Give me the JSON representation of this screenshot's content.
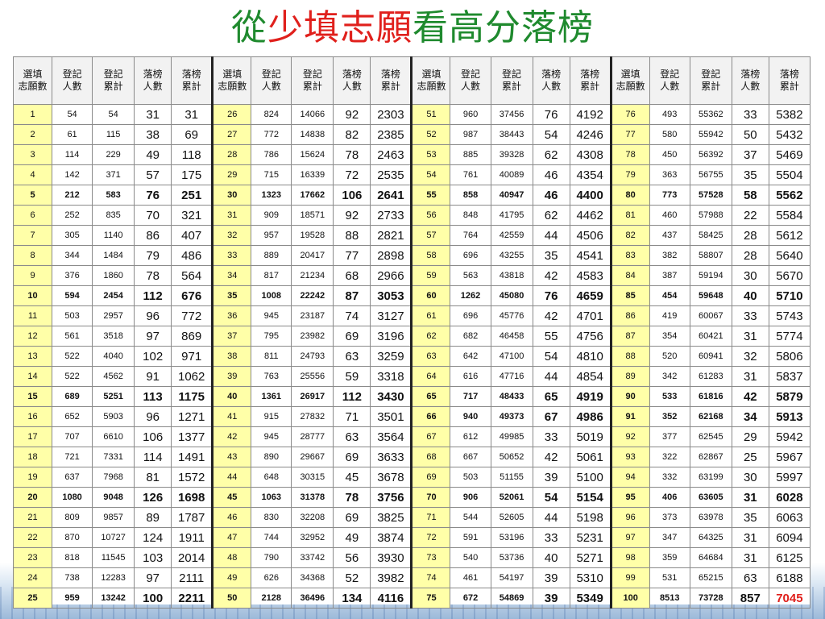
{
  "title": {
    "parts": [
      {
        "text": "從",
        "color": "#1f8a2e"
      },
      {
        "text": "少填志願",
        "color": "#e0201c"
      },
      {
        "text": "看高分落榜",
        "color": "#1f8a2e"
      }
    ]
  },
  "headers": [
    "選填志願數",
    "登記人數",
    "登記累計",
    "落榜人數",
    "落榜累計"
  ],
  "bold_rows": [
    5,
    10,
    15,
    20,
    25
  ],
  "extra_bold": [
    {
      "block": 2,
      "row": 16
    },
    {
      "block": 3,
      "row": 16
    }
  ],
  "highlight_color": "#ffffa8",
  "red_cell": {
    "block": 3,
    "row": 25,
    "col": 4
  },
  "blocks": [
    [
      [
        "1",
        "54",
        "54",
        "31",
        "31"
      ],
      [
        "2",
        "61",
        "115",
        "38",
        "69"
      ],
      [
        "3",
        "114",
        "229",
        "49",
        "118"
      ],
      [
        "4",
        "142",
        "371",
        "57",
        "175"
      ],
      [
        "5",
        "212",
        "583",
        "76",
        "251"
      ],
      [
        "6",
        "252",
        "835",
        "70",
        "321"
      ],
      [
        "7",
        "305",
        "1140",
        "86",
        "407"
      ],
      [
        "8",
        "344",
        "1484",
        "79",
        "486"
      ],
      [
        "9",
        "376",
        "1860",
        "78",
        "564"
      ],
      [
        "10",
        "594",
        "2454",
        "112",
        "676"
      ],
      [
        "11",
        "503",
        "2957",
        "96",
        "772"
      ],
      [
        "12",
        "561",
        "3518",
        "97",
        "869"
      ],
      [
        "13",
        "522",
        "4040",
        "102",
        "971"
      ],
      [
        "14",
        "522",
        "4562",
        "91",
        "1062"
      ],
      [
        "15",
        "689",
        "5251",
        "113",
        "1175"
      ],
      [
        "16",
        "652",
        "5903",
        "96",
        "1271"
      ],
      [
        "17",
        "707",
        "6610",
        "106",
        "1377"
      ],
      [
        "18",
        "721",
        "7331",
        "114",
        "1491"
      ],
      [
        "19",
        "637",
        "7968",
        "81",
        "1572"
      ],
      [
        "20",
        "1080",
        "9048",
        "126",
        "1698"
      ],
      [
        "21",
        "809",
        "9857",
        "89",
        "1787"
      ],
      [
        "22",
        "870",
        "10727",
        "124",
        "1911"
      ],
      [
        "23",
        "818",
        "11545",
        "103",
        "2014"
      ],
      [
        "24",
        "738",
        "12283",
        "97",
        "2111"
      ],
      [
        "25",
        "959",
        "13242",
        "100",
        "2211"
      ]
    ],
    [
      [
        "26",
        "824",
        "14066",
        "92",
        "2303"
      ],
      [
        "27",
        "772",
        "14838",
        "82",
        "2385"
      ],
      [
        "28",
        "786",
        "15624",
        "78",
        "2463"
      ],
      [
        "29",
        "715",
        "16339",
        "72",
        "2535"
      ],
      [
        "30",
        "1323",
        "17662",
        "106",
        "2641"
      ],
      [
        "31",
        "909",
        "18571",
        "92",
        "2733"
      ],
      [
        "32",
        "957",
        "19528",
        "88",
        "2821"
      ],
      [
        "33",
        "889",
        "20417",
        "77",
        "2898"
      ],
      [
        "34",
        "817",
        "21234",
        "68",
        "2966"
      ],
      [
        "35",
        "1008",
        "22242",
        "87",
        "3053"
      ],
      [
        "36",
        "945",
        "23187",
        "74",
        "3127"
      ],
      [
        "37",
        "795",
        "23982",
        "69",
        "3196"
      ],
      [
        "38",
        "811",
        "24793",
        "63",
        "3259"
      ],
      [
        "39",
        "763",
        "25556",
        "59",
        "3318"
      ],
      [
        "40",
        "1361",
        "26917",
        "112",
        "3430"
      ],
      [
        "41",
        "915",
        "27832",
        "71",
        "3501"
      ],
      [
        "42",
        "945",
        "28777",
        "63",
        "3564"
      ],
      [
        "43",
        "890",
        "29667",
        "69",
        "3633"
      ],
      [
        "44",
        "648",
        "30315",
        "45",
        "3678"
      ],
      [
        "45",
        "1063",
        "31378",
        "78",
        "3756"
      ],
      [
        "46",
        "830",
        "32208",
        "69",
        "3825"
      ],
      [
        "47",
        "744",
        "32952",
        "49",
        "3874"
      ],
      [
        "48",
        "790",
        "33742",
        "56",
        "3930"
      ],
      [
        "49",
        "626",
        "34368",
        "52",
        "3982"
      ],
      [
        "50",
        "2128",
        "36496",
        "134",
        "4116"
      ]
    ],
    [
      [
        "51",
        "960",
        "37456",
        "76",
        "4192"
      ],
      [
        "52",
        "987",
        "38443",
        "54",
        "4246"
      ],
      [
        "53",
        "885",
        "39328",
        "62",
        "4308"
      ],
      [
        "54",
        "761",
        "40089",
        "46",
        "4354"
      ],
      [
        "55",
        "858",
        "40947",
        "46",
        "4400"
      ],
      [
        "56",
        "848",
        "41795",
        "62",
        "4462"
      ],
      [
        "57",
        "764",
        "42559",
        "44",
        "4506"
      ],
      [
        "58",
        "696",
        "43255",
        "35",
        "4541"
      ],
      [
        "59",
        "563",
        "43818",
        "42",
        "4583"
      ],
      [
        "60",
        "1262",
        "45080",
        "76",
        "4659"
      ],
      [
        "61",
        "696",
        "45776",
        "42",
        "4701"
      ],
      [
        "62",
        "682",
        "46458",
        "55",
        "4756"
      ],
      [
        "63",
        "642",
        "47100",
        "54",
        "4810"
      ],
      [
        "64",
        "616",
        "47716",
        "44",
        "4854"
      ],
      [
        "65",
        "717",
        "48433",
        "65",
        "4919"
      ],
      [
        "66",
        "940",
        "49373",
        "67",
        "4986"
      ],
      [
        "67",
        "612",
        "49985",
        "33",
        "5019"
      ],
      [
        "68",
        "667",
        "50652",
        "42",
        "5061"
      ],
      [
        "69",
        "503",
        "51155",
        "39",
        "5100"
      ],
      [
        "70",
        "906",
        "52061",
        "54",
        "5154"
      ],
      [
        "71",
        "544",
        "52605",
        "44",
        "5198"
      ],
      [
        "72",
        "591",
        "53196",
        "33",
        "5231"
      ],
      [
        "73",
        "540",
        "53736",
        "40",
        "5271"
      ],
      [
        "74",
        "461",
        "54197",
        "39",
        "5310"
      ],
      [
        "75",
        "672",
        "54869",
        "39",
        "5349"
      ]
    ],
    [
      [
        "76",
        "493",
        "55362",
        "33",
        "5382"
      ],
      [
        "77",
        "580",
        "55942",
        "50",
        "5432"
      ],
      [
        "78",
        "450",
        "56392",
        "37",
        "5469"
      ],
      [
        "79",
        "363",
        "56755",
        "35",
        "5504"
      ],
      [
        "80",
        "773",
        "57528",
        "58",
        "5562"
      ],
      [
        "81",
        "460",
        "57988",
        "22",
        "5584"
      ],
      [
        "82",
        "437",
        "58425",
        "28",
        "5612"
      ],
      [
        "83",
        "382",
        "58807",
        "28",
        "5640"
      ],
      [
        "84",
        "387",
        "59194",
        "30",
        "5670"
      ],
      [
        "85",
        "454",
        "59648",
        "40",
        "5710"
      ],
      [
        "86",
        "419",
        "60067",
        "33",
        "5743"
      ],
      [
        "87",
        "354",
        "60421",
        "31",
        "5774"
      ],
      [
        "88",
        "520",
        "60941",
        "32",
        "5806"
      ],
      [
        "89",
        "342",
        "61283",
        "31",
        "5837"
      ],
      [
        "90",
        "533",
        "61816",
        "42",
        "5879"
      ],
      [
        "91",
        "352",
        "62168",
        "34",
        "5913"
      ],
      [
        "92",
        "377",
        "62545",
        "29",
        "5942"
      ],
      [
        "93",
        "322",
        "62867",
        "25",
        "5967"
      ],
      [
        "94",
        "332",
        "63199",
        "30",
        "5997"
      ],
      [
        "95",
        "406",
        "63605",
        "31",
        "6028"
      ],
      [
        "96",
        "373",
        "63978",
        "35",
        "6063"
      ],
      [
        "97",
        "347",
        "64325",
        "31",
        "6094"
      ],
      [
        "98",
        "359",
        "64684",
        "31",
        "6125"
      ],
      [
        "99",
        "531",
        "65215",
        "63",
        "6188"
      ],
      [
        "100",
        "8513",
        "73728",
        "857",
        "7045"
      ]
    ]
  ]
}
